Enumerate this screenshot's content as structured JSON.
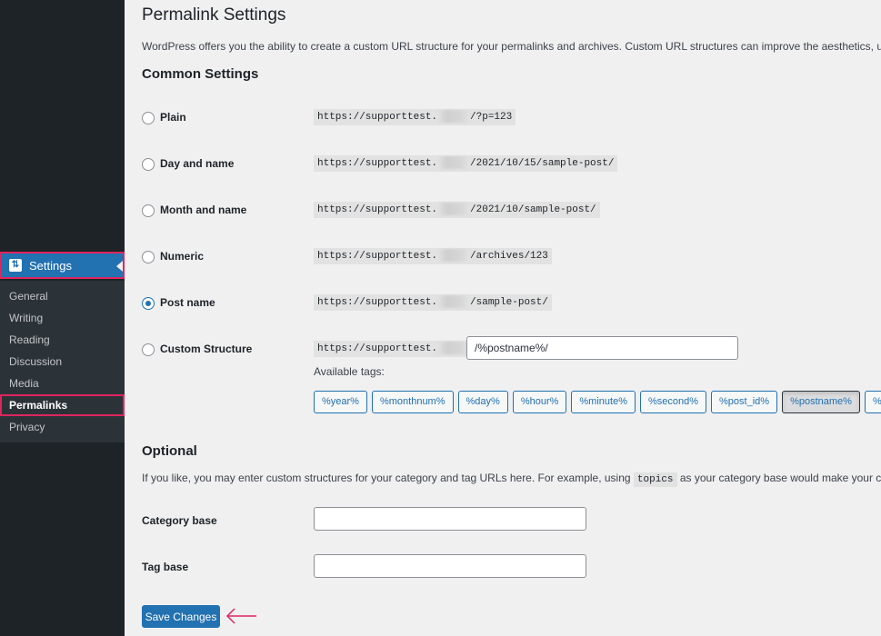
{
  "sidebar": {
    "active_menu": {
      "label": "Settings",
      "icon": "settings-sliders-icon"
    },
    "items": [
      {
        "label": "General",
        "current": false
      },
      {
        "label": "Writing",
        "current": false
      },
      {
        "label": "Reading",
        "current": false
      },
      {
        "label": "Discussion",
        "current": false
      },
      {
        "label": "Media",
        "current": false
      },
      {
        "label": "Permalinks",
        "current": true
      },
      {
        "label": "Privacy",
        "current": false
      }
    ]
  },
  "page": {
    "title": "Permalink Settings",
    "intro": "WordPress offers you the ability to create a custom URL structure for your permalinks and archives. Custom URL structures can improve the aesthetics, usability, and fo"
  },
  "common": {
    "heading": "Common Settings",
    "url_prefix": "https://supporttest.",
    "options": [
      {
        "label": "Plain",
        "suffix": "/?p=123",
        "checked": false
      },
      {
        "label": "Day and name",
        "suffix": "/2021/10/15/sample-post/",
        "checked": false
      },
      {
        "label": "Month and name",
        "suffix": "/2021/10/sample-post/",
        "checked": false
      },
      {
        "label": "Numeric",
        "suffix": "/archives/123",
        "checked": false
      },
      {
        "label": "Post name",
        "suffix": "/sample-post/",
        "checked": true
      },
      {
        "label": "Custom Structure",
        "suffix": "",
        "checked": false
      }
    ],
    "custom_value": "/%postname%/",
    "available_tags_label": "Available tags:",
    "tags": [
      "%year%",
      "%monthnum%",
      "%day%",
      "%hour%",
      "%minute%",
      "%second%",
      "%post_id%",
      "%postname%",
      "%c"
    ],
    "active_tag": "%postname%"
  },
  "optional": {
    "heading": "Optional",
    "desc_before": "If you like, you may enter custom structures for your category and tag URLs here. For example, using ",
    "desc_code": "topics",
    "desc_after": " as your category base would make your category links",
    "category_base_label": "Category base",
    "category_base_value": "",
    "tag_base_label": "Tag base",
    "tag_base_value": ""
  },
  "actions": {
    "save_label": "Save Changes"
  },
  "colors": {
    "accent": "#2271b1",
    "highlight": "#e0245e",
    "sidebar_bg": "#1d2327"
  }
}
